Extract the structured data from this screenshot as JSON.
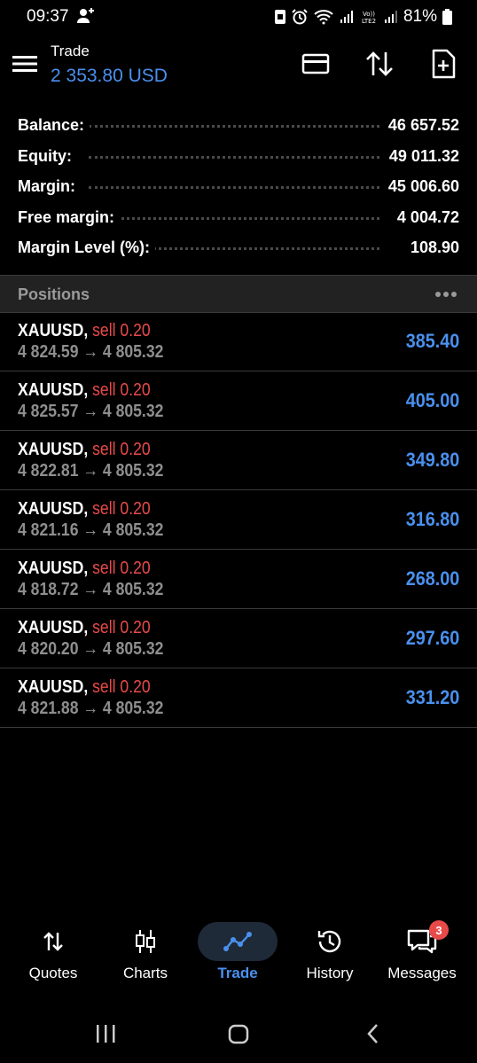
{
  "status_bar": {
    "time": "09:37",
    "battery": "81%"
  },
  "header": {
    "title": "Trade",
    "value": "2 353.80 USD"
  },
  "summary": [
    {
      "label": "Balance:",
      "value": "46 657.52"
    },
    {
      "label": "Equity:",
      "value": "49 011.32"
    },
    {
      "label": "Margin:",
      "value": "45 006.60"
    },
    {
      "label": "Free margin:",
      "value": "4 004.72"
    },
    {
      "label": "Margin Level (%):",
      "value": "108.90"
    }
  ],
  "positions_header": {
    "title": "Positions"
  },
  "positions": [
    {
      "symbol": "XAUUSD,",
      "side": "sell 0.20",
      "prices": "4 824.59 → 4 805.32",
      "profit": "385.40"
    },
    {
      "symbol": "XAUUSD,",
      "side": "sell 0.20",
      "prices": "4 825.57 → 4 805.32",
      "profit": "405.00"
    },
    {
      "symbol": "XAUUSD,",
      "side": "sell 0.20",
      "prices": "4 822.81 → 4 805.32",
      "profit": "349.80"
    },
    {
      "symbol": "XAUUSD,",
      "side": "sell 0.20",
      "prices": "4 821.16 → 4 805.32",
      "profit": "316.80"
    },
    {
      "symbol": "XAUUSD,",
      "side": "sell 0.20",
      "prices": "4 818.72 → 4 805.32",
      "profit": "268.00"
    },
    {
      "symbol": "XAUUSD,",
      "side": "sell 0.20",
      "prices": "4 820.20 → 4 805.32",
      "profit": "297.60"
    },
    {
      "symbol": "XAUUSD,",
      "side": "sell 0.20",
      "prices": "4 821.88 → 4 805.32",
      "profit": "331.20"
    }
  ],
  "nav": {
    "items": [
      {
        "label": "Quotes",
        "icon": "quotes-icon"
      },
      {
        "label": "Charts",
        "icon": "charts-icon"
      },
      {
        "label": "Trade",
        "icon": "trade-icon",
        "active": true
      },
      {
        "label": "History",
        "icon": "history-icon"
      },
      {
        "label": "Messages",
        "icon": "messages-icon",
        "badge": "3"
      }
    ]
  },
  "colors": {
    "accent": "#4a90ee",
    "sell": "#e84a4a",
    "muted": "#8e8e8e",
    "background": "#000000"
  }
}
